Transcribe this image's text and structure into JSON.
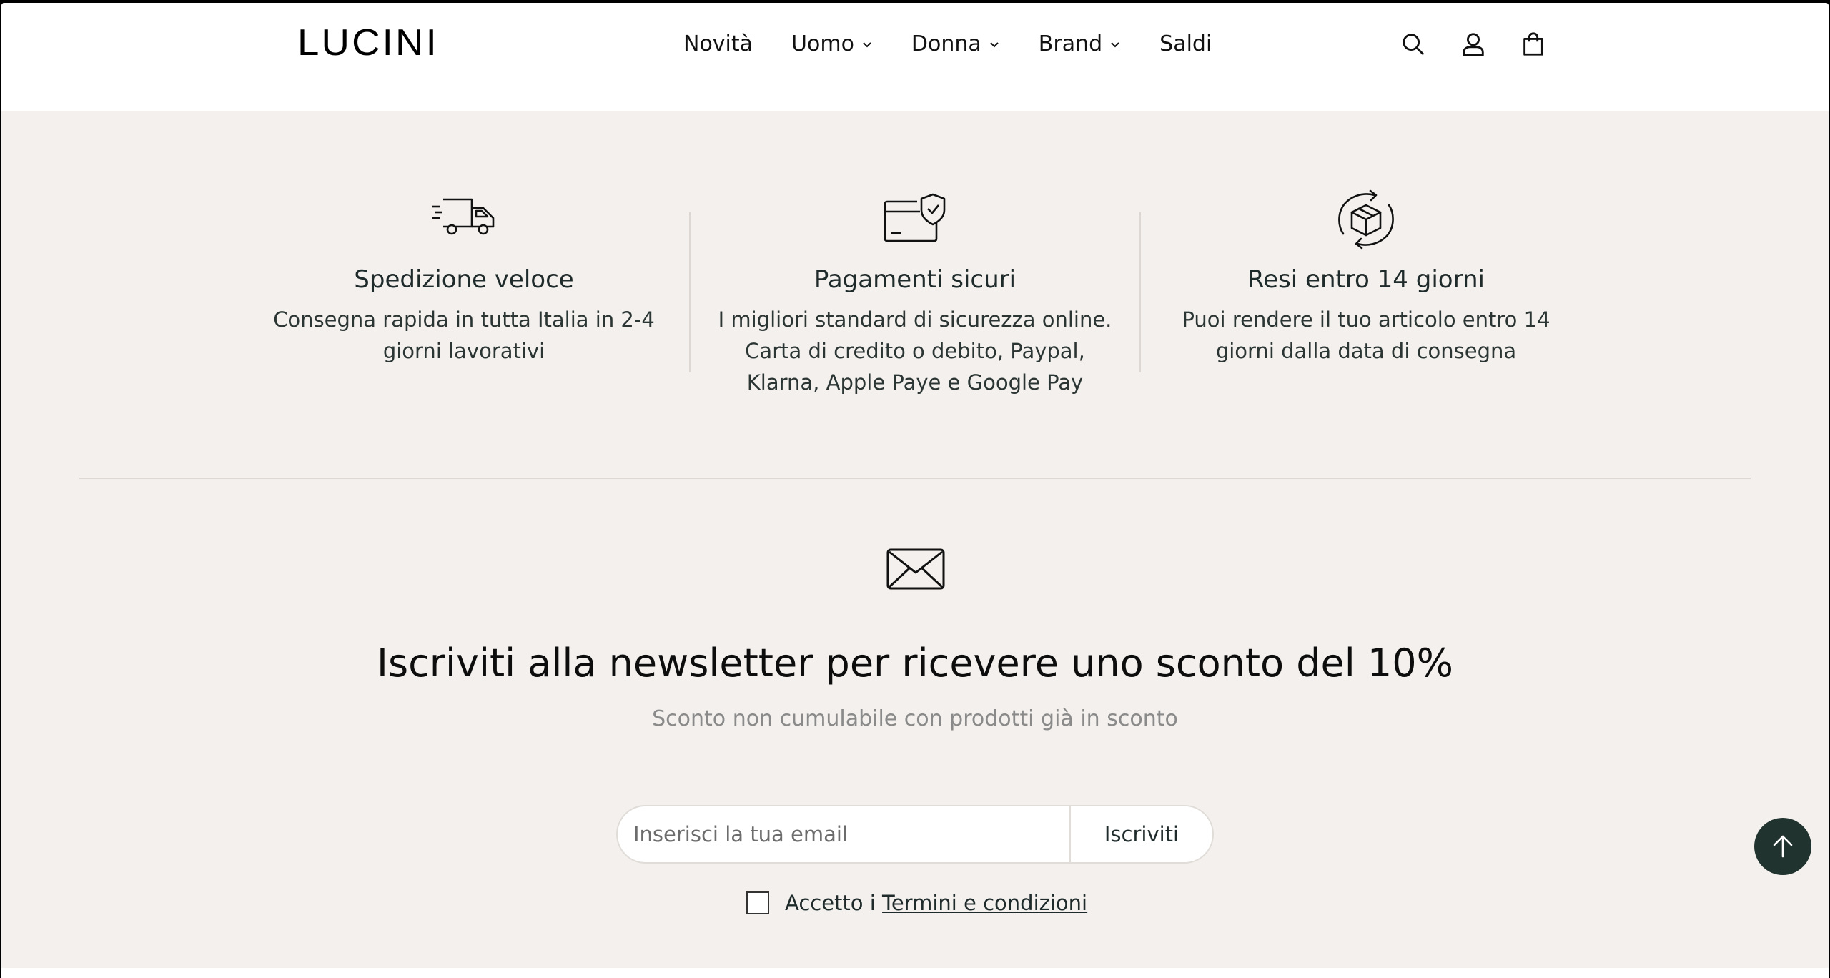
{
  "header": {
    "logo": "LUCINI",
    "nav": [
      {
        "label": "Novità",
        "has_dropdown": false
      },
      {
        "label": "Uomo",
        "has_dropdown": true
      },
      {
        "label": "Donna",
        "has_dropdown": true
      },
      {
        "label": "Brand",
        "has_dropdown": true
      },
      {
        "label": "Saldi",
        "has_dropdown": false
      }
    ],
    "icons": [
      "search-icon",
      "account-icon",
      "cart-icon"
    ]
  },
  "features": [
    {
      "icon": "truck-icon",
      "title": "Spedizione veloce",
      "lines": [
        "Consegna rapida in tutta Italia in 2-4",
        "giorni lavorativi"
      ]
    },
    {
      "icon": "secure-card-icon",
      "title": "Pagamenti sicuri",
      "lines": [
        "I migliori standard di sicurezza online.",
        "Carta di credito o debito, Paypal,",
        "Klarna, Apple Paye e Google Pay"
      ]
    },
    {
      "icon": "return-box-icon",
      "title": "Resi entro 14 giorni",
      "lines": [
        "Puoi rendere il tuo articolo entro 14",
        "giorni dalla data di consegna"
      ]
    }
  ],
  "newsletter": {
    "icon": "envelope-icon",
    "title": "Iscriviti alla newsletter per ricevere uno sconto del 10%",
    "subtitle": "Sconto non cumulabile con prodotti già in sconto",
    "email_placeholder": "Inserisci la tua email",
    "email_value": "",
    "submit_label": "Iscriviti",
    "consent_prefix": "Accetto i ",
    "consent_link": "Termini e condizioni",
    "consent_checked": false
  },
  "colors": {
    "background": "#f3f0ed",
    "header": "#ffffff",
    "accent_dark": "#21332f",
    "muted_text": "#8a8a8a"
  }
}
